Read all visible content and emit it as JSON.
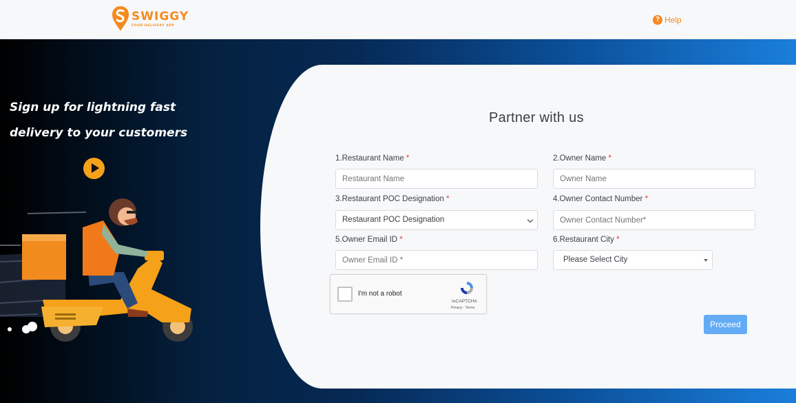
{
  "header": {
    "brand_name": "SWIGGY",
    "brand_tagline": "FOOD DELIVERY APP",
    "help_label": "Help"
  },
  "hero": {
    "tagline_line1": "Sign up for lightning fast",
    "tagline_line2": "delivery to your customers"
  },
  "form": {
    "title": "Partner with us",
    "required_mark": "*",
    "fields": {
      "restaurant_name": {
        "label": "1.Restaurant Name",
        "placeholder": "Restaurant Name"
      },
      "owner_name": {
        "label": "2.Owner Name",
        "placeholder": "Owner Name"
      },
      "poc_designation": {
        "label": "3.Restaurant POC Designation",
        "value": "Restaurant POC Designation"
      },
      "owner_contact": {
        "label": "4.Owner Contact Number",
        "placeholder": "Owner Contact Number*"
      },
      "owner_email": {
        "label": "5.Owner Email ID",
        "placeholder": "Owner Email ID *"
      },
      "restaurant_city": {
        "label": "6.Restaurant City",
        "value": "Please Select City"
      }
    },
    "captcha": {
      "label": "I'm not a robot",
      "brand": "reCAPTCHA",
      "terms": "Privacy - Terms"
    },
    "proceed_label": "Proceed"
  },
  "colors": {
    "brand": "#f58a1f",
    "button": "#63acf5",
    "required": "#e53935"
  }
}
